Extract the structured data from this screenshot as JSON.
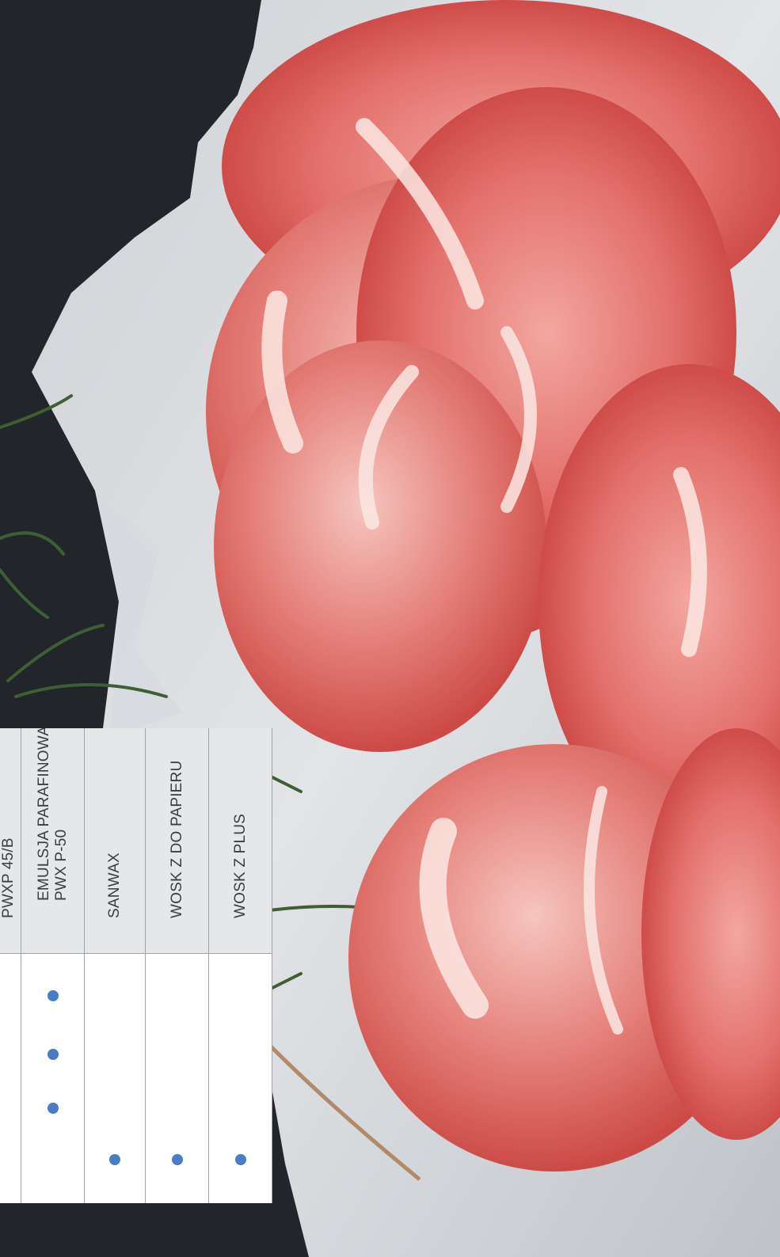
{
  "table": {
    "columns": [
      {
        "lines": [
          "PWXP 45/B"
        ],
        "dots": []
      },
      {
        "lines": [
          "EMULSJA PARAFINOWA",
          "PWX P-50"
        ],
        "dots": [
          "row1",
          "row2",
          "row3"
        ]
      },
      {
        "lines": [
          "SANWAX"
        ],
        "dots": [
          "row4"
        ]
      },
      {
        "lines": [
          "WOSK Z DO PAPIERU"
        ],
        "dots": [
          "row4"
        ]
      },
      {
        "lines": [
          "WOSK Z PLUS"
        ],
        "dots": [
          "row4"
        ]
      }
    ]
  },
  "colors": {
    "dot": "#4a7cc1",
    "header_bg": "#e6e7e9",
    "body_bg": "#ffffff",
    "background": "#1f2226"
  }
}
